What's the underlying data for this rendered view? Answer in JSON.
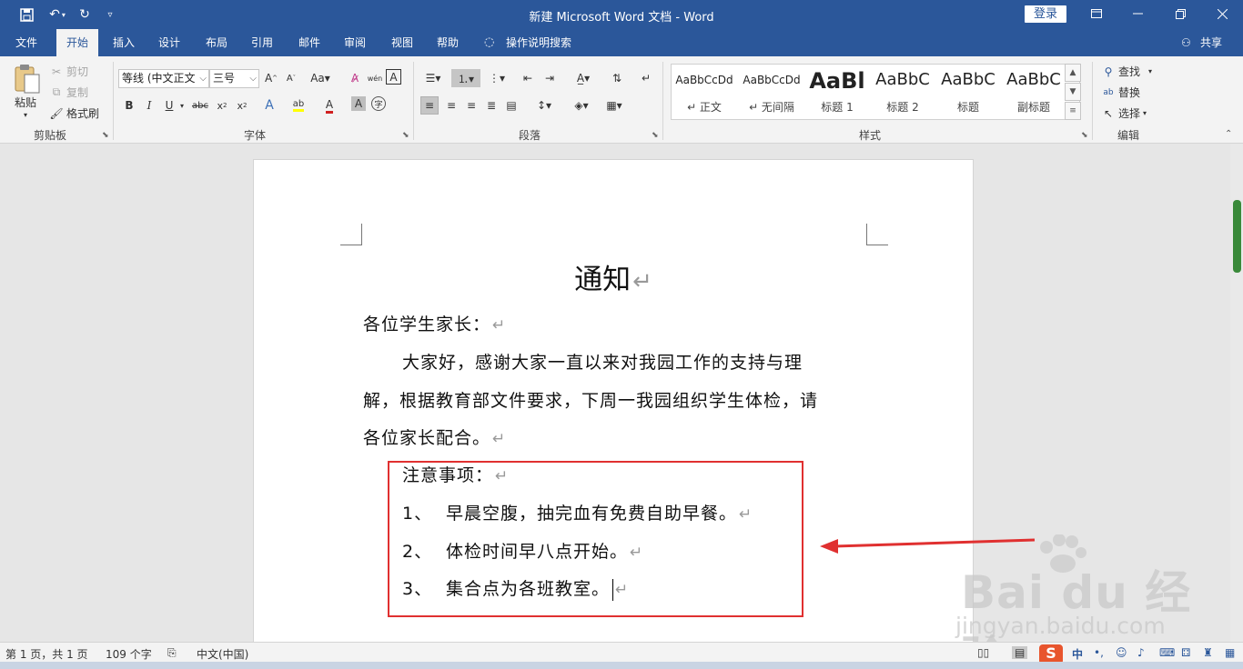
{
  "titlebar": {
    "title": "新建 Microsoft Word 文档  -  Word",
    "login": "登录",
    "quick_access": [
      "save-icon",
      "undo-icon",
      "redo-icon",
      "customize-icon"
    ]
  },
  "tabs": [
    {
      "label": "文件",
      "active": false
    },
    {
      "label": "开始",
      "active": true
    },
    {
      "label": "插入",
      "active": false
    },
    {
      "label": "设计",
      "active": false
    },
    {
      "label": "布局",
      "active": false
    },
    {
      "label": "引用",
      "active": false
    },
    {
      "label": "邮件",
      "active": false
    },
    {
      "label": "审阅",
      "active": false
    },
    {
      "label": "视图",
      "active": false
    },
    {
      "label": "帮助",
      "active": false
    }
  ],
  "tell_me": "操作说明搜索",
  "share": "共享",
  "ribbon": {
    "clipboard": {
      "label": "剪贴板",
      "paste": "粘贴",
      "cut": "剪切",
      "copy": "复制",
      "format_painter": "格式刷"
    },
    "font": {
      "label": "字体",
      "font_name": "等线 (中文正文",
      "font_size": "三号"
    },
    "paragraph": {
      "label": "段落"
    },
    "styles": {
      "label": "样式",
      "items": [
        {
          "preview": "AaBbCcDd",
          "name": "↵ 正文"
        },
        {
          "preview": "AaBbCcDd",
          "name": "↵ 无间隔"
        },
        {
          "preview": "AaBl",
          "name": "标题 1"
        },
        {
          "preview": "AaBbC",
          "name": "标题 2"
        },
        {
          "preview": "AaBbC",
          "name": "标题"
        },
        {
          "preview": "AaBbC",
          "name": "副标题"
        }
      ]
    },
    "editing": {
      "label": "编辑",
      "find": "查找",
      "replace": "替换",
      "select": "选择"
    }
  },
  "document": {
    "heading": "通知",
    "greeting": "各位学生家长：",
    "body_line1": "大家好，感谢大家一直以来对我园工作的支持与理",
    "body_line2": "解，根据教育部文件要求，下周一我园组织学生体检，请",
    "body_line3": "各位家长配合。",
    "notes_title": "注意事项：",
    "notes": [
      {
        "num": "1、",
        "text": "早晨空腹，抽完血有免费自助早餐。"
      },
      {
        "num": "2、",
        "text": "体检时间早八点开始。"
      },
      {
        "num": "3、",
        "text": "集合点为各班教室。"
      }
    ],
    "paragraph_mark": "↵"
  },
  "statusbar": {
    "page": "第 1 页，共 1 页",
    "words": "109 个字",
    "language": "中文(中国)"
  },
  "watermark": {
    "brand": "Bai du 经验",
    "url": "jingyan.baidu.com"
  },
  "colors": {
    "word_blue": "#2b579a",
    "annotation_red": "#e03030"
  }
}
